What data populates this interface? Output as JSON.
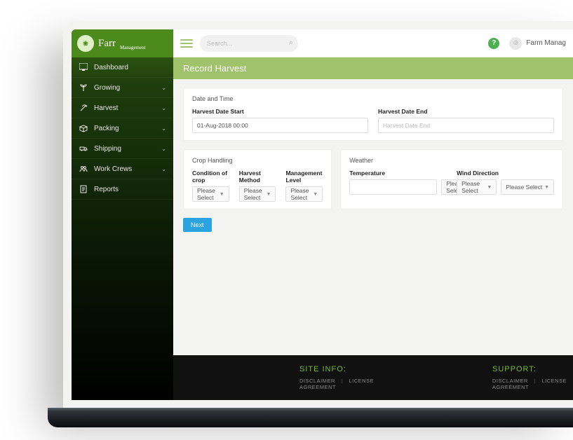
{
  "brand": {
    "name": "Farr",
    "sub": "Management"
  },
  "sidebar": {
    "items": [
      {
        "label": "Dashboard",
        "expandable": false
      },
      {
        "label": "Growing",
        "expandable": true
      },
      {
        "label": "Harvest",
        "expandable": true
      },
      {
        "label": "Packing",
        "expandable": true
      },
      {
        "label": "Shipping",
        "expandable": true
      },
      {
        "label": "Work Crews",
        "expandable": true
      },
      {
        "label": "Reports",
        "expandable": false
      }
    ]
  },
  "topbar": {
    "search_placeholder": "Search...",
    "user_name": "Farm Manag"
  },
  "page": {
    "title": "Record Harvest"
  },
  "sections": {
    "datetime": {
      "title": "Date and Time",
      "start_label": "Harvest Date Start",
      "start_value": "01-Aug-2018 00:00",
      "end_label": "Harvest Date End",
      "end_placeholder": "Harvest Date End"
    },
    "crop": {
      "title": "Crop Handling",
      "condition_label": "Condition of crop",
      "method_label": "Harvest Method",
      "mgmt_label": "Management Level",
      "select_placeholder": "Please Select"
    },
    "weather": {
      "title": "Weather",
      "temp_label": "Temperature",
      "temp_unit_placeholder": "Please Select",
      "wind_label": "Wind Direction",
      "wind_speed_placeholder": "Please Select",
      "wind_dir_placeholder": "Please Select"
    }
  },
  "buttons": {
    "next": "Next"
  },
  "footer": {
    "siteinfo_title": "SITE INFO:",
    "support_title": "SUPPORT:",
    "disclaimer": "DISCLAIMER",
    "license": "LICENSE AGREEMENT"
  }
}
